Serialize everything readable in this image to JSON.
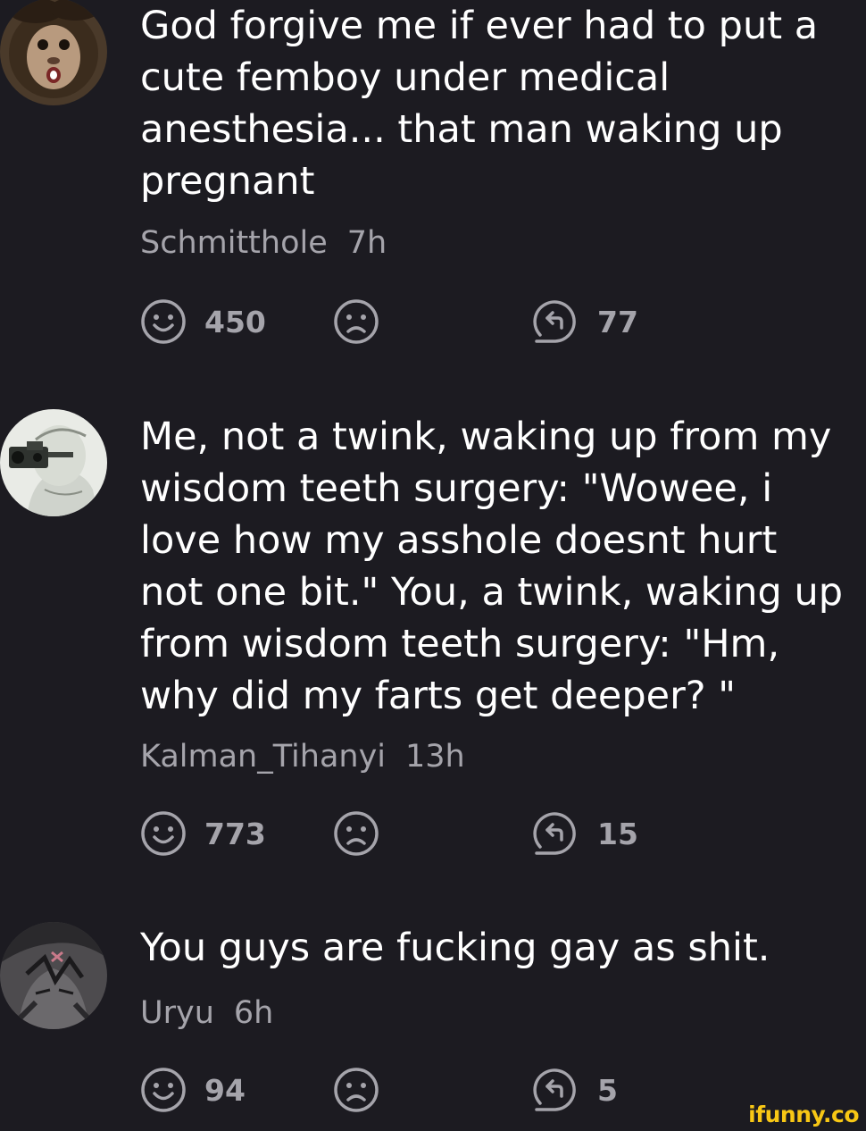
{
  "comments": [
    {
      "avatar": "monkey-avatar",
      "text_lines": [
        "God forgive me if ever had to put a",
        "cute femboy under medical",
        "anesthesia... that man waking up",
        "pregnant"
      ],
      "username": "Schmitthole",
      "time": "7h",
      "smiles": "450",
      "unsmiles": "",
      "replies": "77"
    },
    {
      "avatar": "camera-man-avatar",
      "text_lines": [
        "Me, not a twink, waking up from my",
        "wisdom teeth surgery: \"Wowee, i",
        "love how my asshole doesnt hurt",
        "not one bit.\" You, a twink, waking up",
        "from wisdom teeth surgery: \"Hm,",
        "why did my farts get deeper? \""
      ],
      "username": "Kalman_Tihanyi",
      "time": "13h",
      "smiles": "773",
      "unsmiles": "",
      "replies": "15"
    },
    {
      "avatar": "anime-avatar",
      "text_lines": [
        "You guys are fucking gay as shit."
      ],
      "username": "Uryu",
      "time": "6h",
      "smiles": "94",
      "unsmiles": "",
      "replies": "5"
    }
  ],
  "icons": {
    "smile": "smile-icon",
    "unsmile": "unsmile-icon",
    "reply": "reply-icon"
  },
  "watermark": "ifunny.co",
  "colors": {
    "background": "#1c1b21",
    "text": "#ffffff",
    "meta": "#a5a4ab",
    "icon": "#a5a4ab",
    "watermark": "#f8c715"
  }
}
